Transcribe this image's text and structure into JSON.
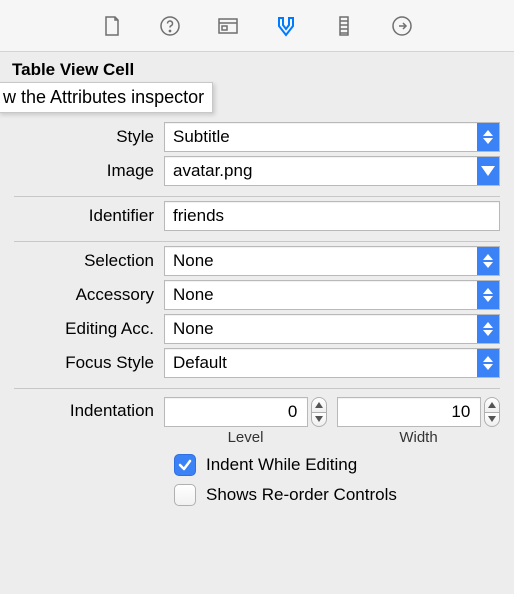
{
  "toolbar": {
    "icons": [
      "file-icon",
      "help-icon",
      "identity-icon",
      "attributes-icon",
      "size-icon",
      "connections-icon"
    ],
    "active_index": 3
  },
  "tooltip_text": "w the Attributes inspector",
  "section_title": "Table View Cell",
  "fields": {
    "style": {
      "label": "Style",
      "value": "Subtitle"
    },
    "image": {
      "label": "Image",
      "value": "avatar.png"
    },
    "identifier": {
      "label": "Identifier",
      "value": "friends"
    },
    "selection": {
      "label": "Selection",
      "value": "None"
    },
    "accessory": {
      "label": "Accessory",
      "value": "None"
    },
    "editing_acc": {
      "label": "Editing Acc.",
      "value": "None"
    },
    "focus_style": {
      "label": "Focus Style",
      "value": "Default"
    }
  },
  "indentation": {
    "label": "Indentation",
    "level_value": "0",
    "level_label": "Level",
    "width_value": "10",
    "width_label": "Width"
  },
  "checkboxes": {
    "indent_while_editing": {
      "label": "Indent While Editing",
      "checked": true
    },
    "shows_reorder": {
      "label": "Shows Re-order Controls",
      "checked": false
    }
  }
}
